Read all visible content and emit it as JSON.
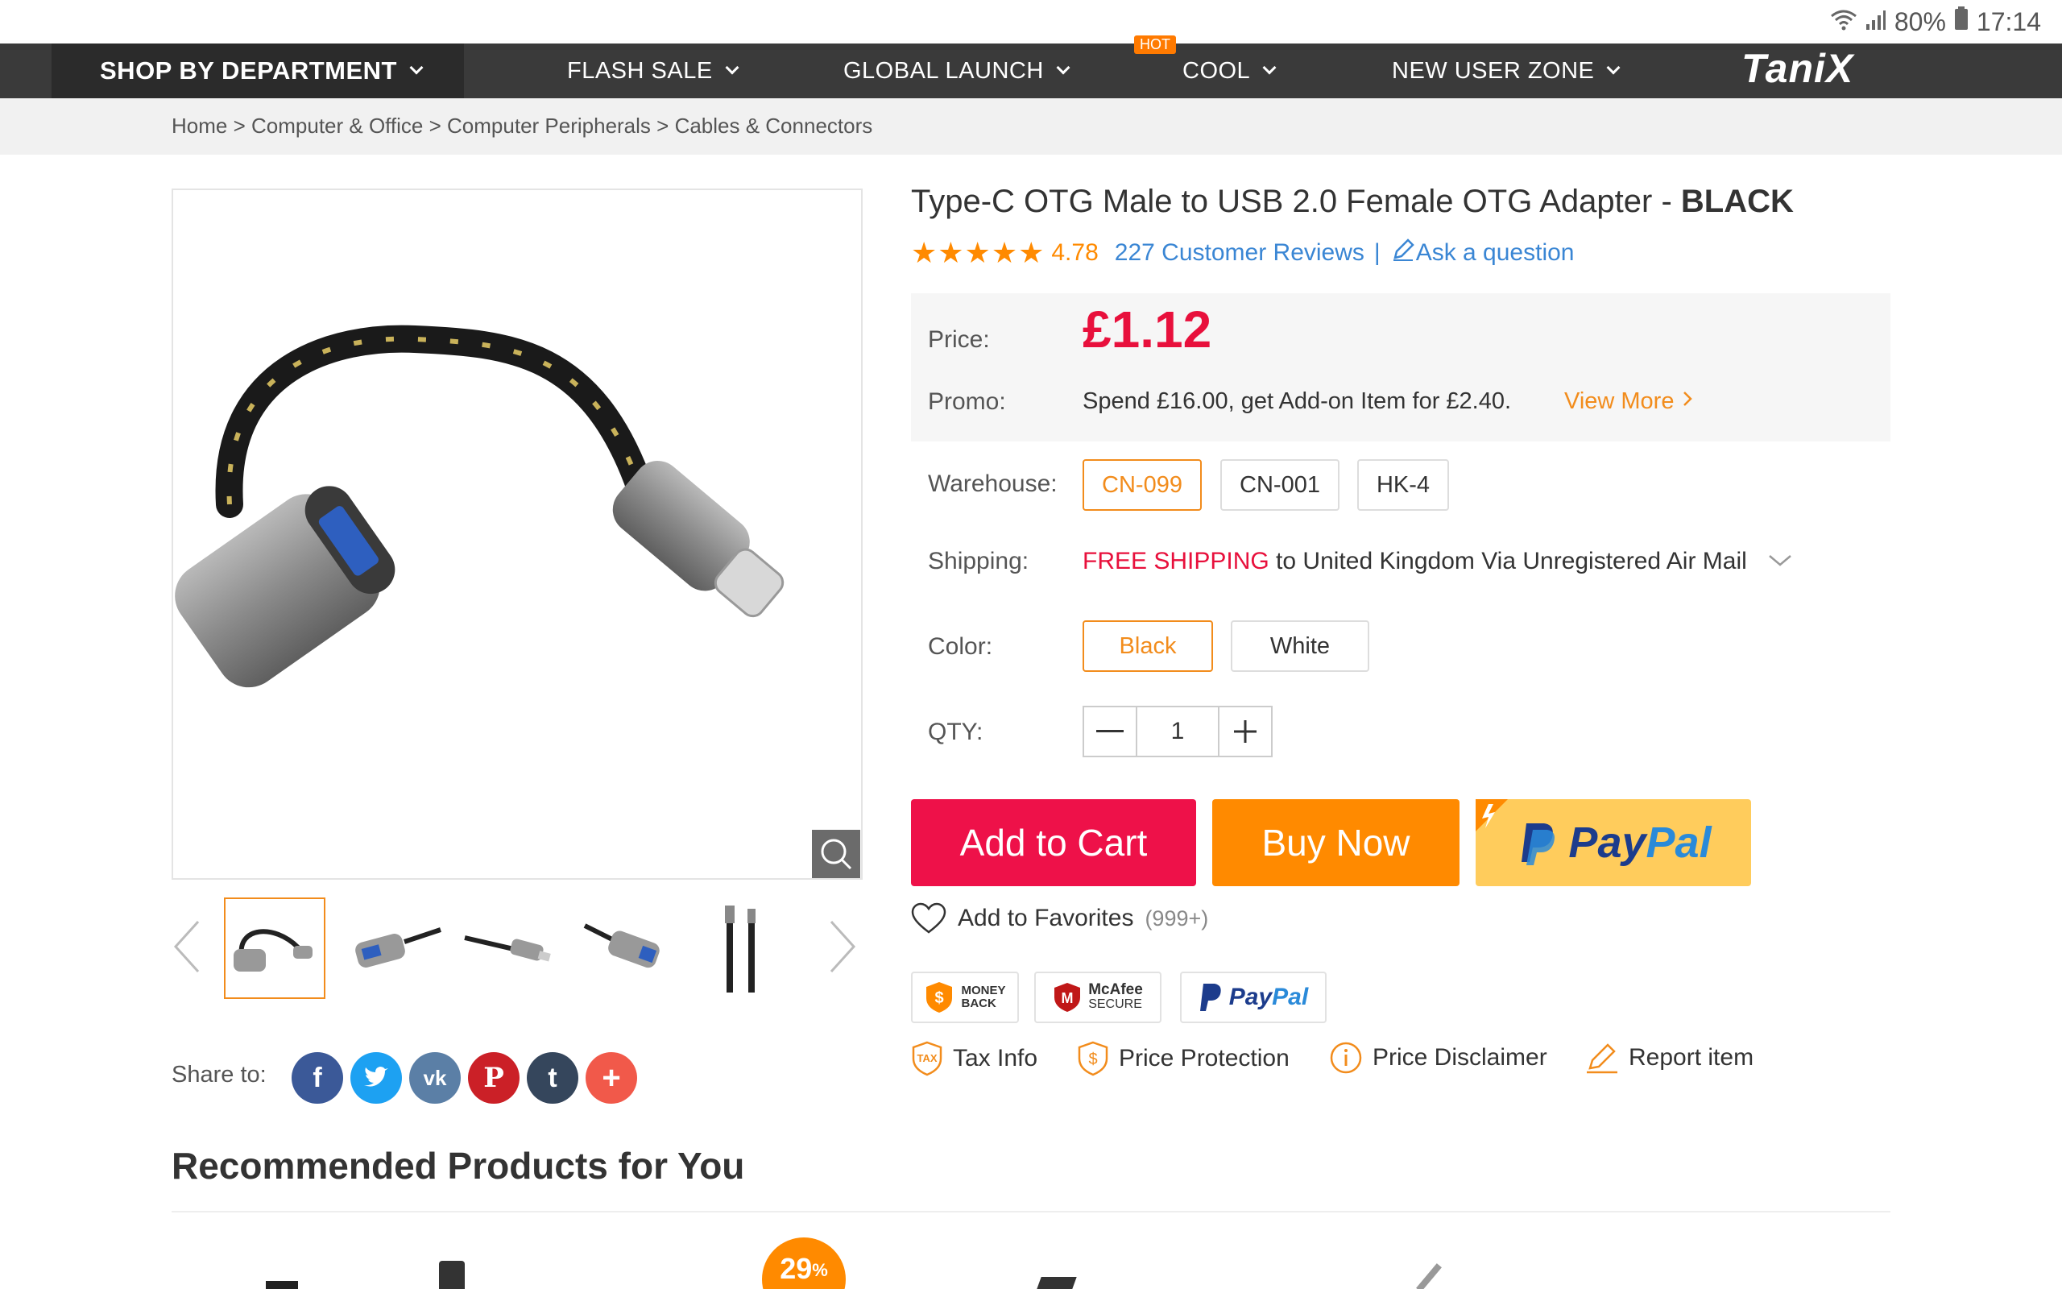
{
  "status": {
    "battery": "80%",
    "time": "17:14"
  },
  "nav": {
    "shop_department": "SHOP BY DEPARTMENT",
    "flash_sale": "FLASH SALE",
    "global_launch": "GLOBAL LAUNCH",
    "hot_badge": "HOT",
    "cool": "COOL",
    "new_user_zone": "NEW USER ZONE",
    "logo": "TaniX"
  },
  "breadcrumb": [
    "Home",
    "Computer & Office",
    "Computer Peripherals",
    "Cables & Connectors"
  ],
  "product": {
    "title": "Type-C OTG Male to USB 2.0 Female OTG Adapter - ",
    "title_variant": "BLACK",
    "rating": "4.78",
    "reviews": "227 Customer Reviews",
    "separator": "|",
    "ask": "Ask a question",
    "price_label": "Price:",
    "price": "£1.12",
    "promo_label": "Promo:",
    "promo_text": "Spend £16.00, get Add-on Item for £2.40.",
    "view_more": "View More",
    "warehouse_label": "Warehouse:",
    "warehouses": [
      "CN-099",
      "CN-001",
      "HK-4"
    ],
    "selected_warehouse": "CN-099",
    "shipping_label": "Shipping:",
    "shipping_free": "FREE SHIPPING",
    "shipping_rest": " to United Kingdom Via Unregistered Air Mail",
    "color_label": "Color:",
    "colors": [
      "Black",
      "White"
    ],
    "selected_color": "Black",
    "qty_label": "QTY:",
    "qty": "1",
    "add_to_cart": "Add to Cart",
    "buy_now": "Buy Now",
    "paypal_1": "Pay",
    "paypal_2": "Pal",
    "add_fav": "Add to Favorites",
    "fav_count": "(999+)"
  },
  "badges": {
    "money_back_1": "MONEY",
    "money_back_2": "BACK",
    "mcafee_1": "McAfee",
    "mcafee_2": "SECURE",
    "paypal_1": "Pay",
    "paypal_2": "Pal"
  },
  "links": {
    "tax": "Tax Info",
    "tax_icon": "TAX",
    "price_protection": "Price Protection",
    "price_disclaimer": "Price Disclaimer",
    "report": "Report item"
  },
  "share": {
    "label": "Share to:"
  },
  "recommended": {
    "title": "Recommended Products for You",
    "discount": "29",
    "discount_unit": "%"
  },
  "colors": {
    "accent": "#f28c1c",
    "price": "#e8103c",
    "cart": "#ee1149",
    "buy": "#ff8a00",
    "link": "#3a86d4"
  }
}
